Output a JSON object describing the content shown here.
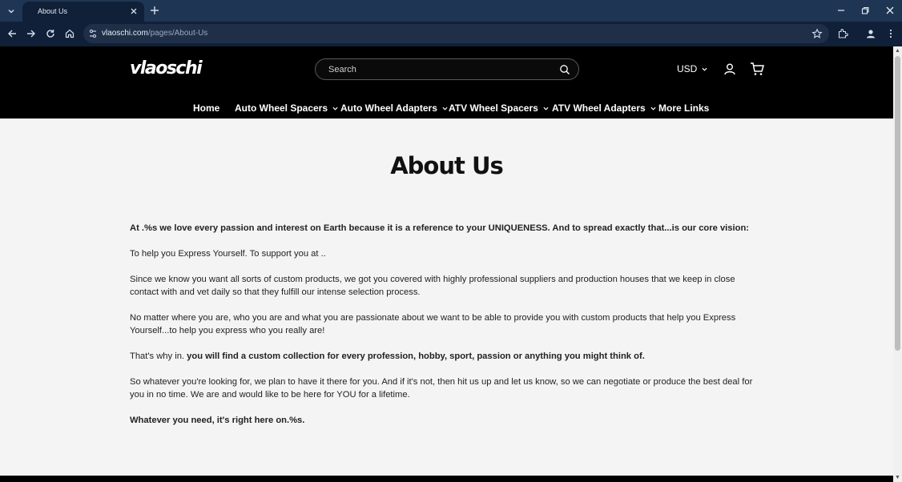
{
  "browser": {
    "tab_title": "About Us",
    "url_host": "vlaoschi.com",
    "url_path": "/pages/About-Us"
  },
  "header": {
    "logo": "vlaoschi",
    "search_placeholder": "Search",
    "currency": "USD"
  },
  "nav": {
    "items": [
      {
        "label": "Home"
      },
      {
        "label": "Auto Wheel Spacers"
      },
      {
        "label": "Auto Wheel Adapters"
      },
      {
        "label": "ATV Wheel Spacers"
      },
      {
        "label": "ATV Wheel Adapters"
      },
      {
        "label": "More Links"
      }
    ]
  },
  "page": {
    "title": "About Us",
    "p1": "At .%s we love every passion and interest on Earth because it is a reference to your UNIQUENESS. And to spread exactly that...is our core vision:",
    "p2": "To help you Express Yourself. To support you at ..",
    "p3": "Since we know you want all sorts of custom products, we got you covered with highly professional suppliers and production houses that we keep in close contact with and vet daily so that they fulfill our intense selection process.",
    "p4": "No matter where you are, who you are and what you are passionate about we want to be able to provide you with custom products that help you Express Yourself...to help you express who you really are!",
    "p5a": "That's why in. ",
    "p5b": "you will find a custom collection for every profession, hobby, sport, passion or anything you might think of.",
    "p6": "So whatever you're looking for, we plan to have it there for you. And if it's not, then hit us up and let us know, so we can negotiate or produce the best deal for you in no time. We are and would like to be here for YOU for a lifetime.",
    "p7": "Whatever you need, it's right here on.%s."
  }
}
